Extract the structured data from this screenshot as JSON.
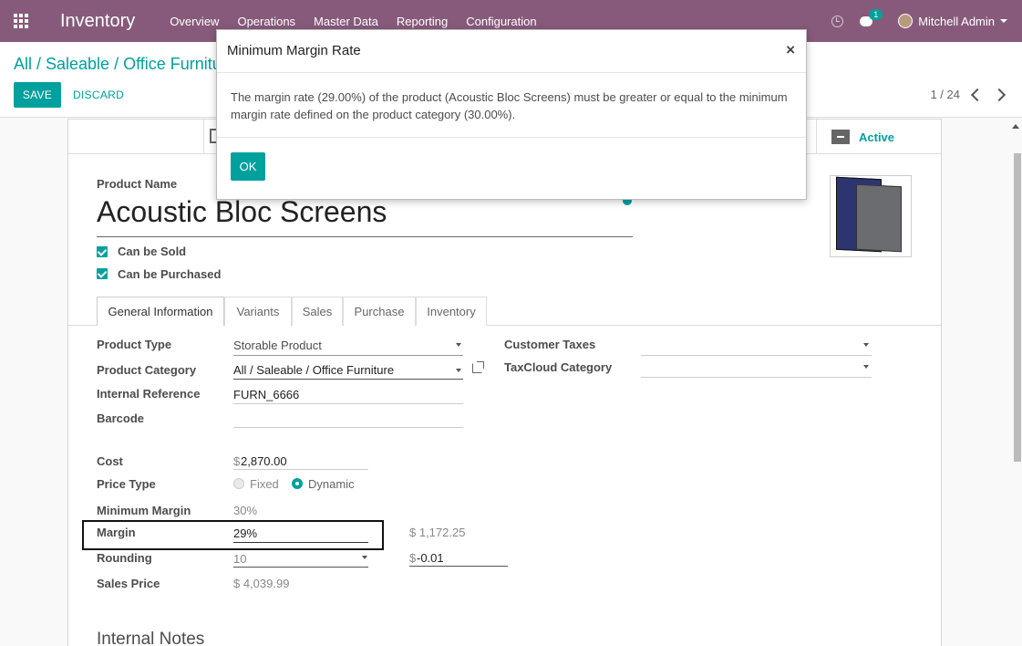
{
  "navbar": {
    "app_title": "Inventory",
    "menu": [
      "Overview",
      "Operations",
      "Master Data",
      "Reporting",
      "Configuration"
    ],
    "chat_badge": "1",
    "user_name": "Mitchell Admin"
  },
  "control_panel": {
    "breadcrumb": "All / Saleable / Office Furnitu",
    "save_label": "Save",
    "discard_label": "Discard",
    "pager": "1 / 24"
  },
  "button_box": {
    "active_label": "Active"
  },
  "product": {
    "name_label": "Product Name",
    "name": "Acoustic Bloc Screens",
    "can_be_sold": "Can be Sold",
    "can_be_purchased": "Can be Purchased"
  },
  "tabs": [
    "General Information",
    "Variants",
    "Sales",
    "Purchase",
    "Inventory"
  ],
  "general": {
    "product_type_label": "Product Type",
    "product_type": "Storable Product",
    "product_category_label": "Product Category",
    "product_category": "All / Saleable / Office Furniture",
    "internal_reference_label": "Internal Reference",
    "internal_reference": "FURN_6666",
    "barcode_label": "Barcode",
    "customer_taxes_label": "Customer Taxes",
    "taxcloud_category_label": "TaxCloud Category",
    "cost_label": "Cost",
    "cost_currency": "$",
    "cost": "2,870.00",
    "price_type_label": "Price Type",
    "price_type_fixed": "Fixed",
    "price_type_dynamic": "Dynamic",
    "minimum_margin_label": "Minimum Margin",
    "minimum_margin": "30%",
    "margin_label": "Margin",
    "margin": "29%",
    "margin_amount": "$ 1,172.25",
    "rounding_label": "Rounding",
    "rounding": "10",
    "rounding_currency": "$",
    "rounding_amount": "-0.01",
    "sales_price_label": "Sales Price",
    "sales_price": "$ 4,039.99",
    "internal_notes_heading": "Internal Notes"
  },
  "modal": {
    "title": "Minimum Margin Rate",
    "close": "×",
    "message": "The margin rate (29.00%) of the product (Acoustic Bloc Screens) must be greater or equal to the minimum margin rate defined on the product category (30.00%).",
    "ok_label": "OK"
  },
  "colors": {
    "navbar": "#875a7b",
    "accent": "#00a09d"
  }
}
